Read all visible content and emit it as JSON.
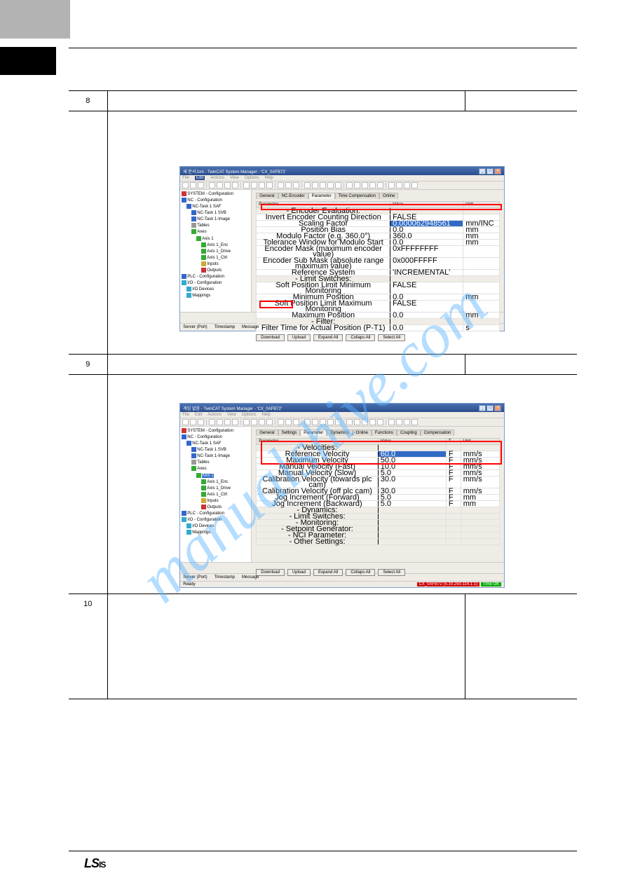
{
  "watermark": "manualshive.com",
  "footer_logo_main": "LS",
  "footer_logo_sub": "IS",
  "rows": {
    "r8": "8",
    "r9": "9",
    "r10": "10"
  },
  "screenshot1": {
    "title": "새 문서.tsm - TwinCAT System Manager - 'CX_0AFB72'",
    "menu": [
      "File",
      "Edit",
      "Actions",
      "View",
      "Options",
      "Help"
    ],
    "menu_active": "Edit",
    "tree": [
      {
        "indent": 0,
        "iconClass": "ic-red",
        "label": "SYSTEM - Configuration"
      },
      {
        "indent": 0,
        "iconClass": "ic-blue",
        "label": "NC - Configuration"
      },
      {
        "indent": 1,
        "iconClass": "ic-blue",
        "label": "NC-Task 1 SAF"
      },
      {
        "indent": 2,
        "iconClass": "ic-blue",
        "label": "NC-Task 1 SVB"
      },
      {
        "indent": 2,
        "iconClass": "ic-blue",
        "label": "NC-Task 1-Image"
      },
      {
        "indent": 2,
        "iconClass": "ic-grey",
        "label": "Tables"
      },
      {
        "indent": 2,
        "iconClass": "ic-green",
        "label": "Axes"
      },
      {
        "indent": 3,
        "iconClass": "ic-green",
        "label": "Axis 1"
      },
      {
        "indent": 4,
        "iconClass": "ic-green",
        "label": "Axis 1_Enc"
      },
      {
        "indent": 4,
        "iconClass": "ic-green",
        "label": "Axis 1_Drive"
      },
      {
        "indent": 4,
        "iconClass": "ic-green",
        "label": "Axis 1_Ctrl"
      },
      {
        "indent": 4,
        "iconClass": "ic-yellow",
        "label": "Inputs"
      },
      {
        "indent": 4,
        "iconClass": "ic-red",
        "label": "Outputs"
      },
      {
        "indent": 0,
        "iconClass": "ic-blue",
        "label": "PLC - Configuration"
      },
      {
        "indent": 0,
        "iconClass": "ic-cyan",
        "label": "I/O - Configuration"
      },
      {
        "indent": 1,
        "iconClass": "ic-cyan",
        "label": "I/O Devices"
      },
      {
        "indent": 1,
        "iconClass": "ic-cyan",
        "label": "Mappings"
      }
    ],
    "tabs": [
      "General",
      "NC-Encoder",
      "Parameter",
      "Time Compensation",
      "Online"
    ],
    "tab_active": 2,
    "headers": {
      "param": "Parameter",
      "value": "Value",
      "unit": "Unit"
    },
    "params": [
      {
        "group": true,
        "name": "Encoder Evaluation:",
        "value": "",
        "unit": ""
      },
      {
        "name": "Invert Encoder Counting Direction",
        "value": "FALSE",
        "unit": ""
      },
      {
        "hl": true,
        "name": "Scaling Factor",
        "value": "0.000062948561",
        "vclass": "sel-blue",
        "unit": "mm/INC"
      },
      {
        "name": "Position Bias",
        "value": "0.0",
        "unit": "mm"
      },
      {
        "name": "Modulo Factor (e.g. 360.0°)",
        "value": "360.0",
        "unit": "mm"
      },
      {
        "name": "Tolerance Window for Modulo Start",
        "value": "0.0",
        "unit": "mm"
      },
      {
        "name": "Encoder Mask (maximum encoder value)",
        "value": "0xFFFFFFFF",
        "unit": ""
      },
      {
        "name": "Encoder Sub Mask (absolute range maximum value)",
        "value": "0x000FFFFF",
        "unit": ""
      },
      {
        "name": "Reference System",
        "value": "'INCREMENTAL'",
        "unit": ""
      },
      {
        "group": true,
        "name": "Limit Switches:",
        "value": "",
        "unit": ""
      },
      {
        "name": "Soft Position Limit Minimum Monitoring",
        "value": "FALSE",
        "unit": ""
      },
      {
        "name": "Minimum Position",
        "value": "0.0",
        "unit": "mm"
      },
      {
        "name": "Soft Position Limit Maximum Monitoring",
        "value": "FALSE",
        "unit": ""
      },
      {
        "name": "Maximum Position",
        "value": "0.0",
        "unit": "mm"
      },
      {
        "group": true,
        "name": "Filter:",
        "value": "",
        "unit": ""
      },
      {
        "name": "Filter Time for Actual Position (P-T1)",
        "value": "0.0",
        "unit": "s"
      }
    ],
    "buttons": [
      "Download",
      "Upload",
      "Expand All",
      "Collaps All",
      "Select All"
    ],
    "status": {
      "server": "Server (Port)",
      "timestamp": "Timestamp",
      "message": "Message"
    }
  },
  "screenshot2": {
    "title": "게임 없음 - TwinCAT System Manager - 'CX_0AFB72'",
    "menu": [
      "File",
      "Edit",
      "Actions",
      "View",
      "Options",
      "Help"
    ],
    "tree": [
      {
        "indent": 0,
        "iconClass": "ic-red",
        "label": "SYSTEM - Configuration"
      },
      {
        "indent": 0,
        "iconClass": "ic-blue",
        "label": "NC - Configuration"
      },
      {
        "indent": 1,
        "iconClass": "ic-blue",
        "label": "NC-Task 1 SAF"
      },
      {
        "indent": 2,
        "iconClass": "ic-blue",
        "label": "NC-Task 1 SVB"
      },
      {
        "indent": 2,
        "iconClass": "ic-blue",
        "label": "NC-Task 1-Image"
      },
      {
        "indent": 2,
        "iconClass": "ic-grey",
        "label": "Tables"
      },
      {
        "indent": 2,
        "iconClass": "ic-green",
        "label": "Axes"
      },
      {
        "indent": 3,
        "iconClass": "ic-green",
        "label": "Axis 1",
        "sel": true
      },
      {
        "indent": 4,
        "iconClass": "ic-green",
        "label": "Axis 1_Enc"
      },
      {
        "indent": 4,
        "iconClass": "ic-green",
        "label": "Axis 1_Drive"
      },
      {
        "indent": 4,
        "iconClass": "ic-green",
        "label": "Axis 1_Ctrl"
      },
      {
        "indent": 4,
        "iconClass": "ic-yellow",
        "label": "Inputs"
      },
      {
        "indent": 4,
        "iconClass": "ic-red",
        "label": "Outputs"
      },
      {
        "indent": 0,
        "iconClass": "ic-blue",
        "label": "PLC - Configuration"
      },
      {
        "indent": 0,
        "iconClass": "ic-cyan",
        "label": "I/O - Configuration"
      },
      {
        "indent": 1,
        "iconClass": "ic-cyan",
        "label": "I/O Devices"
      },
      {
        "indent": 1,
        "iconClass": "ic-cyan",
        "label": "Mappings"
      }
    ],
    "tabs": [
      "General",
      "Settings",
      "Parameter",
      "Dynamics",
      "Online",
      "Functions",
      "Coupling",
      "Compensation"
    ],
    "tab_active": 2,
    "headers": {
      "param": "Parameter",
      "value": "Value",
      "t": "T",
      "unit": "Unit"
    },
    "params": [
      {
        "group": true,
        "name": "Velocities:",
        "value": "",
        "t": "",
        "unit": ""
      },
      {
        "hl": true,
        "name": "Reference Velocity",
        "value": "60.0",
        "vclass": "sel-blue",
        "t": "F",
        "unit": "mm/s"
      },
      {
        "hl": true,
        "name": "Maximum Velocity",
        "value": "50.0",
        "t": "F",
        "unit": "mm/s"
      },
      {
        "hl": true,
        "name": "Manual Velocity (Fast)",
        "value": "10.0",
        "t": "F",
        "unit": "mm/s"
      },
      {
        "hl": true,
        "name": "Manual Velocity (Slow)",
        "value": "5.0",
        "t": "F",
        "unit": "mm/s"
      },
      {
        "name": "Calibration Velocity (towards plc cam)",
        "value": "30.0",
        "t": "F",
        "unit": "mm/s"
      },
      {
        "name": "Calibration Velocity (off plc cam)",
        "value": "30.0",
        "t": "F",
        "unit": "mm/s"
      },
      {
        "name": "Jog Increment (Forward)",
        "value": "5.0",
        "t": "F",
        "unit": "mm"
      },
      {
        "name": "Jog Increment (Backward)",
        "value": "5.0",
        "t": "F",
        "unit": "mm"
      },
      {
        "group": true,
        "name": "Dynamics:",
        "value": "",
        "t": "",
        "unit": ""
      },
      {
        "group": true,
        "name": "Limit Switches:",
        "value": "",
        "t": "",
        "unit": ""
      },
      {
        "group": true,
        "name": "Monitoring:",
        "value": "",
        "t": "",
        "unit": ""
      },
      {
        "group": true,
        "name": "Setpoint Generator:",
        "value": "",
        "t": "",
        "unit": ""
      },
      {
        "group": true,
        "name": "NCI Parameter:",
        "value": "",
        "t": "",
        "unit": ""
      },
      {
        "group": true,
        "name": "Other Settings:",
        "value": "",
        "t": "",
        "unit": ""
      }
    ],
    "buttons": [
      "Download",
      "Upload",
      "Expand All",
      "Collaps All",
      "Select All"
    ],
    "status": {
      "server": "Server (Port)",
      "timestamp": "Timestamp",
      "message": "Message"
    },
    "ready": "Ready",
    "ready_red": "CX_0AFB72 (5.10.250.114.1.1)",
    "ready_green": "Time OK"
  }
}
